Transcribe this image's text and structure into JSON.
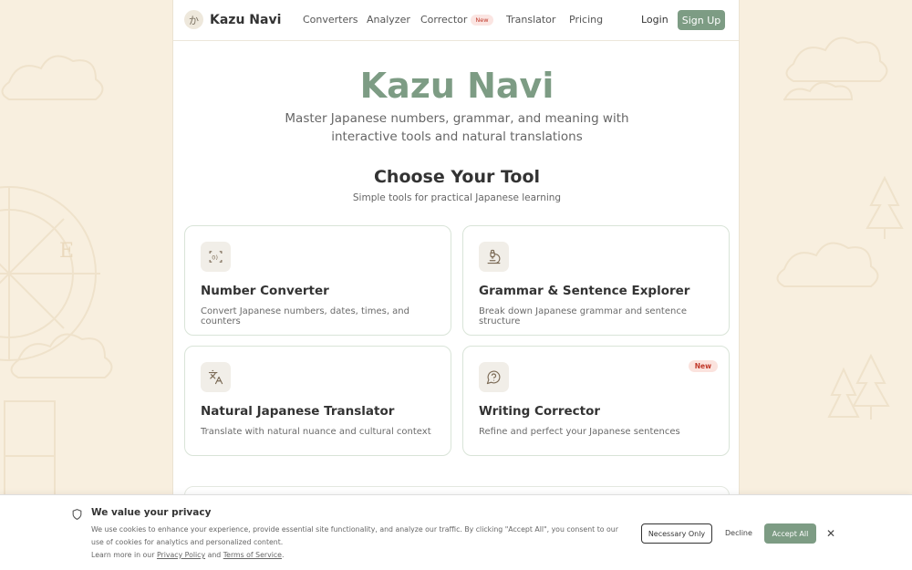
{
  "nav": {
    "logo_glyph": "か",
    "brand": "Kazu Navi",
    "links": [
      "Converters",
      "Analyzer",
      "Corrector",
      "Translator",
      "Pricing"
    ],
    "corrector_badge": "New",
    "login": "Login",
    "signup": "Sign Up"
  },
  "hero": {
    "title": "Kazu Navi",
    "subtitle": "Master Japanese numbers, grammar, and meaning with interactive tools and natural translations"
  },
  "tools": {
    "title": "Choose Your Tool",
    "subtitle": "Simple tools for practical Japanese learning",
    "cards": [
      {
        "icon": "number-convert-icon",
        "title": "Number Converter",
        "desc": "Convert Japanese numbers, dates, times, and counters"
      },
      {
        "icon": "microscope-icon",
        "title": "Grammar & Sentence Explorer",
        "desc": "Break down Japanese grammar and sentence structure"
      },
      {
        "icon": "translate-icon",
        "title": "Natural Japanese Translator",
        "desc": "Translate with natural nuance and cultural context"
      },
      {
        "icon": "chat-question-icon",
        "title": "Writing Corrector",
        "desc": "Refine and perfect your Japanese sentences",
        "badge": "New"
      }
    ]
  },
  "cookie": {
    "title": "We value your privacy",
    "text": "We use cookies to enhance your experience, provide essential site functionality, and analyze our traffic. By clicking \"Accept All\", you consent to our use of cookies for analytics and personalized content.",
    "learn_prefix": "Learn more in our",
    "privacy": "Privacy Policy",
    "and": "and",
    "terms": "Terms of Service",
    "period": ".",
    "necessary": "Necessary Only",
    "decline": "Decline",
    "accept": "Accept All",
    "close": "✕"
  },
  "colors": {
    "accent": "#7d9c84",
    "background": "#f8efdf",
    "badge": "#c0392b"
  }
}
